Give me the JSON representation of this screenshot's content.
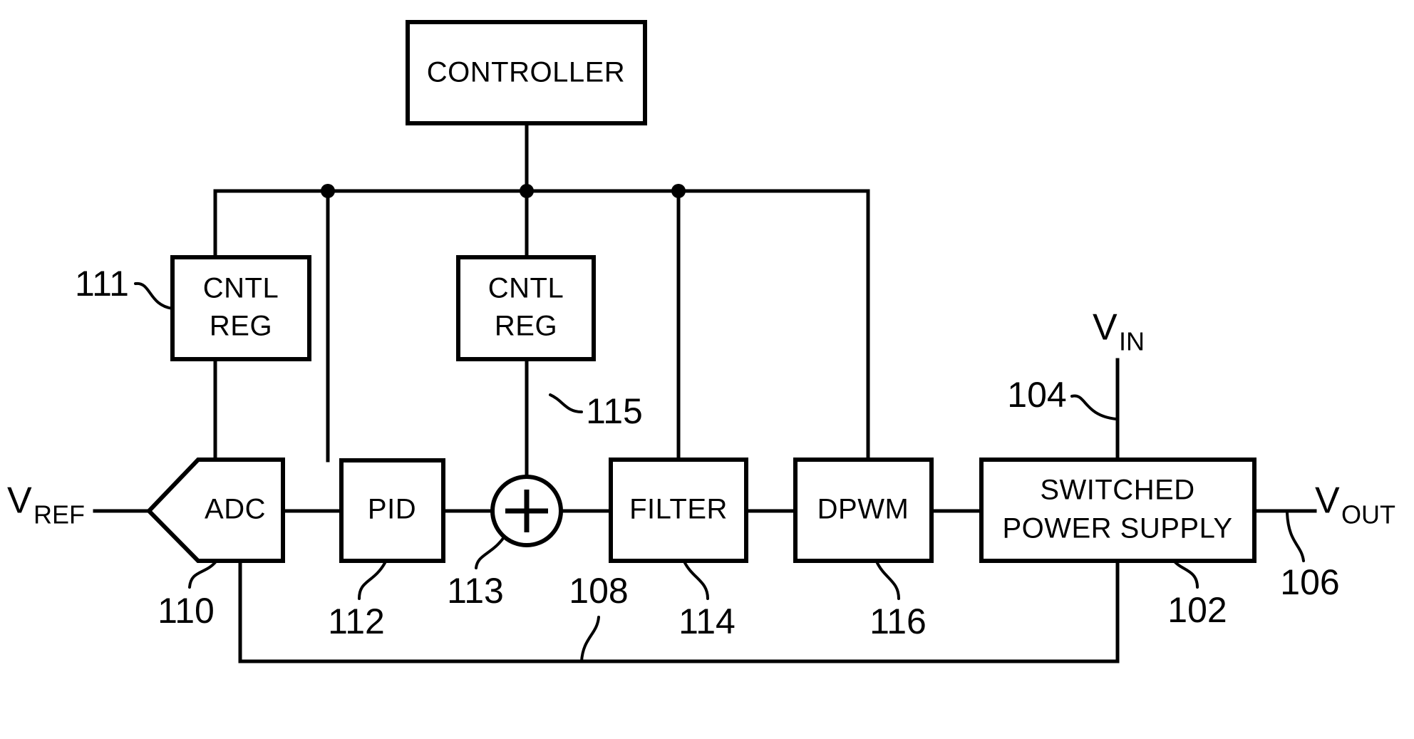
{
  "figure": {
    "type": "patent-block-diagram",
    "title": "Digitally controlled switched power supply block diagram",
    "background_color": "#ffffff",
    "line_color": "#000000"
  },
  "blocks": [
    {
      "id": "controller",
      "name": "controller-block",
      "label": "CONTROLLER",
      "lines": [
        "CONTROLLER"
      ],
      "shape": "rect"
    },
    {
      "id": "cntl_reg_1",
      "name": "cntl-reg-block-1",
      "label": "CNTL REG",
      "lines": [
        "CNTL",
        "REG"
      ],
      "shape": "rect"
    },
    {
      "id": "cntl_reg_2",
      "name": "cntl-reg-block-2",
      "label": "CNTL REG",
      "lines": [
        "CNTL",
        "REG"
      ],
      "shape": "rect"
    },
    {
      "id": "adc",
      "name": "adc-block",
      "label": "ADC",
      "lines": [
        "ADC"
      ],
      "shape": "pentagon"
    },
    {
      "id": "pid",
      "name": "pid-block",
      "label": "PID",
      "lines": [
        "PID"
      ],
      "shape": "rect"
    },
    {
      "id": "summer",
      "name": "summing-junction",
      "label": "+",
      "lines": [
        "+"
      ],
      "shape": "circle-plus"
    },
    {
      "id": "filter",
      "name": "filter-block",
      "label": "FILTER",
      "lines": [
        "FILTER"
      ],
      "shape": "rect"
    },
    {
      "id": "dpwm",
      "name": "dpwm-block",
      "label": "DPWM",
      "lines": [
        "DPWM"
      ],
      "shape": "rect"
    },
    {
      "id": "sps",
      "name": "switched-power-supply-block",
      "label": "SWITCHED POWER SUPPLY",
      "lines": [
        "SWITCHED",
        "POWER SUPPLY"
      ],
      "shape": "rect"
    }
  ],
  "signal_labels": [
    {
      "id": "vref",
      "name": "vref-label",
      "base": "V",
      "sub": "REF"
    },
    {
      "id": "vin",
      "name": "vin-label",
      "base": "V",
      "sub": "IN"
    },
    {
      "id": "vout",
      "name": "vout-label",
      "base": "V",
      "sub": "OUT"
    }
  ],
  "reference_numerals": [
    {
      "id": "n111",
      "name": "reference-numeral-111",
      "text": "111",
      "refers_to": "cntl_reg_1"
    },
    {
      "id": "n115",
      "name": "reference-numeral-115",
      "text": "115",
      "refers_to": "cntl_reg_2_output"
    },
    {
      "id": "n104",
      "name": "reference-numeral-104",
      "text": "104",
      "refers_to": "vin"
    },
    {
      "id": "n110",
      "name": "reference-numeral-110",
      "text": "110",
      "refers_to": "adc"
    },
    {
      "id": "n112",
      "name": "reference-numeral-112",
      "text": "112",
      "refers_to": "pid"
    },
    {
      "id": "n113",
      "name": "reference-numeral-113",
      "text": "113",
      "refers_to": "summer"
    },
    {
      "id": "n108",
      "name": "reference-numeral-108",
      "text": "108",
      "refers_to": "feedback_path"
    },
    {
      "id": "n114",
      "name": "reference-numeral-114",
      "text": "114",
      "refers_to": "filter"
    },
    {
      "id": "n116",
      "name": "reference-numeral-116",
      "text": "116",
      "refers_to": "dpwm"
    },
    {
      "id": "n102",
      "name": "reference-numeral-102",
      "text": "102",
      "refers_to": "sps"
    },
    {
      "id": "n106",
      "name": "reference-numeral-106",
      "text": "106",
      "refers_to": "vout"
    }
  ],
  "connections": [
    {
      "name": "controller-to-bus",
      "from": "controller",
      "to": "control-bus"
    },
    {
      "name": "bus-to-cntl-reg-1",
      "from": "control-bus",
      "to": "cntl_reg_1"
    },
    {
      "name": "bus-to-cntl-reg-2",
      "from": "control-bus",
      "to": "cntl_reg_2"
    },
    {
      "name": "bus-to-filter",
      "from": "control-bus",
      "to": "filter"
    },
    {
      "name": "bus-to-dpwm",
      "from": "control-bus",
      "to": "dpwm"
    },
    {
      "name": "cntl-reg-1-to-adc",
      "from": "cntl_reg_1",
      "to": "adc"
    },
    {
      "name": "cntl-reg-2-to-summer",
      "from": "cntl_reg_2",
      "to": "summer"
    },
    {
      "name": "vref-to-adc",
      "from": "vref",
      "to": "adc"
    },
    {
      "name": "adc-to-pid",
      "from": "adc",
      "to": "pid"
    },
    {
      "name": "pid-to-summer",
      "from": "pid",
      "to": "summer"
    },
    {
      "name": "summer-to-filter",
      "from": "summer",
      "to": "filter"
    },
    {
      "name": "filter-to-dpwm",
      "from": "filter",
      "to": "dpwm"
    },
    {
      "name": "dpwm-to-sps",
      "from": "dpwm",
      "to": "sps"
    },
    {
      "name": "vin-to-sps",
      "from": "vin",
      "to": "sps"
    },
    {
      "name": "sps-to-vout",
      "from": "sps",
      "to": "vout"
    },
    {
      "name": "feedback-sps-to-adc",
      "from": "sps",
      "to": "adc"
    }
  ]
}
